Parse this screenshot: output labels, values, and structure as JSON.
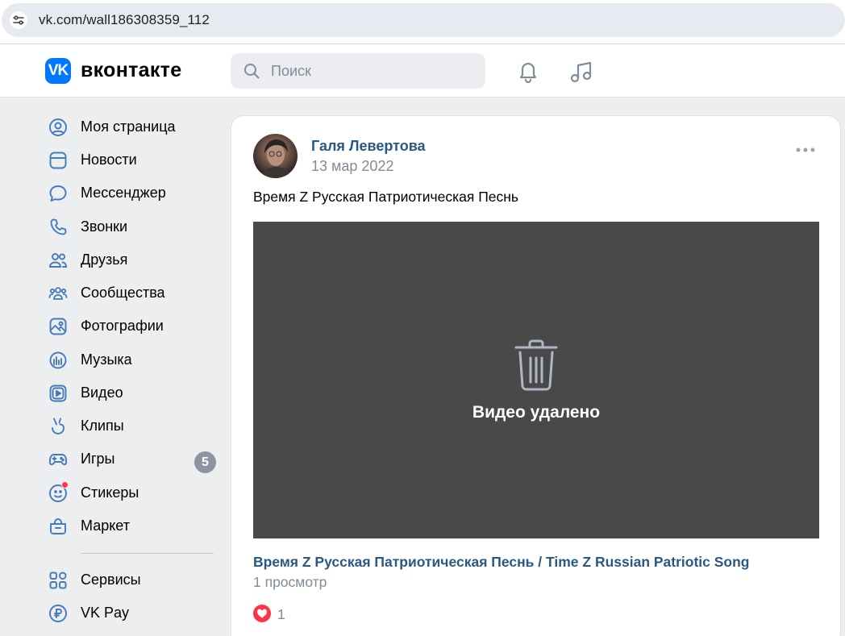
{
  "browser": {
    "url": "vk.com/wall186308359_112",
    "site_info_icon": "tune-icon"
  },
  "header": {
    "logo_text": "вконтакте",
    "logo_letter": "VK",
    "search_placeholder": "Поиск",
    "icons": [
      "bell-icon",
      "music-icon"
    ]
  },
  "sidebar": {
    "items": [
      {
        "label": "Моя страница",
        "icon": "user-circle-icon"
      },
      {
        "label": "Новости",
        "icon": "newsfeed-icon"
      },
      {
        "label": "Мессенджер",
        "icon": "message-icon"
      },
      {
        "label": "Звонки",
        "icon": "phone-icon"
      },
      {
        "label": "Друзья",
        "icon": "friends-icon"
      },
      {
        "label": "Сообщества",
        "icon": "communities-icon"
      },
      {
        "label": "Фотографии",
        "icon": "photo-icon"
      },
      {
        "label": "Музыка",
        "icon": "music-library-icon"
      },
      {
        "label": "Видео",
        "icon": "video-icon"
      },
      {
        "label": "Клипы",
        "icon": "clips-icon"
      },
      {
        "label": "Игры",
        "icon": "gamepad-icon",
        "badge": "5"
      },
      {
        "label": "Стикеры",
        "icon": "sticker-icon"
      },
      {
        "label": "Маркет",
        "icon": "market-icon"
      }
    ],
    "extra_items": [
      {
        "label": "Сервисы",
        "icon": "services-icon"
      },
      {
        "label": "VK Pay",
        "icon": "vkpay-icon"
      }
    ]
  },
  "post": {
    "author": "Галя Левертова",
    "date": "13 мар 2022",
    "text": "Время Z Русская Патриотическая Песнь",
    "video_status": "Видео удалено",
    "video_title": "Время Z Русская Патриотическая Песнь / Time Z Russian Patriotic Song",
    "views": "1 просмотр",
    "likes": "1"
  },
  "colors": {
    "accent": "#0077ff",
    "link": "#2a5885",
    "muted": "#818c99",
    "icon": "#447bba",
    "background": "#edeef0",
    "video_bg": "#494949",
    "like": "#ff3347"
  }
}
